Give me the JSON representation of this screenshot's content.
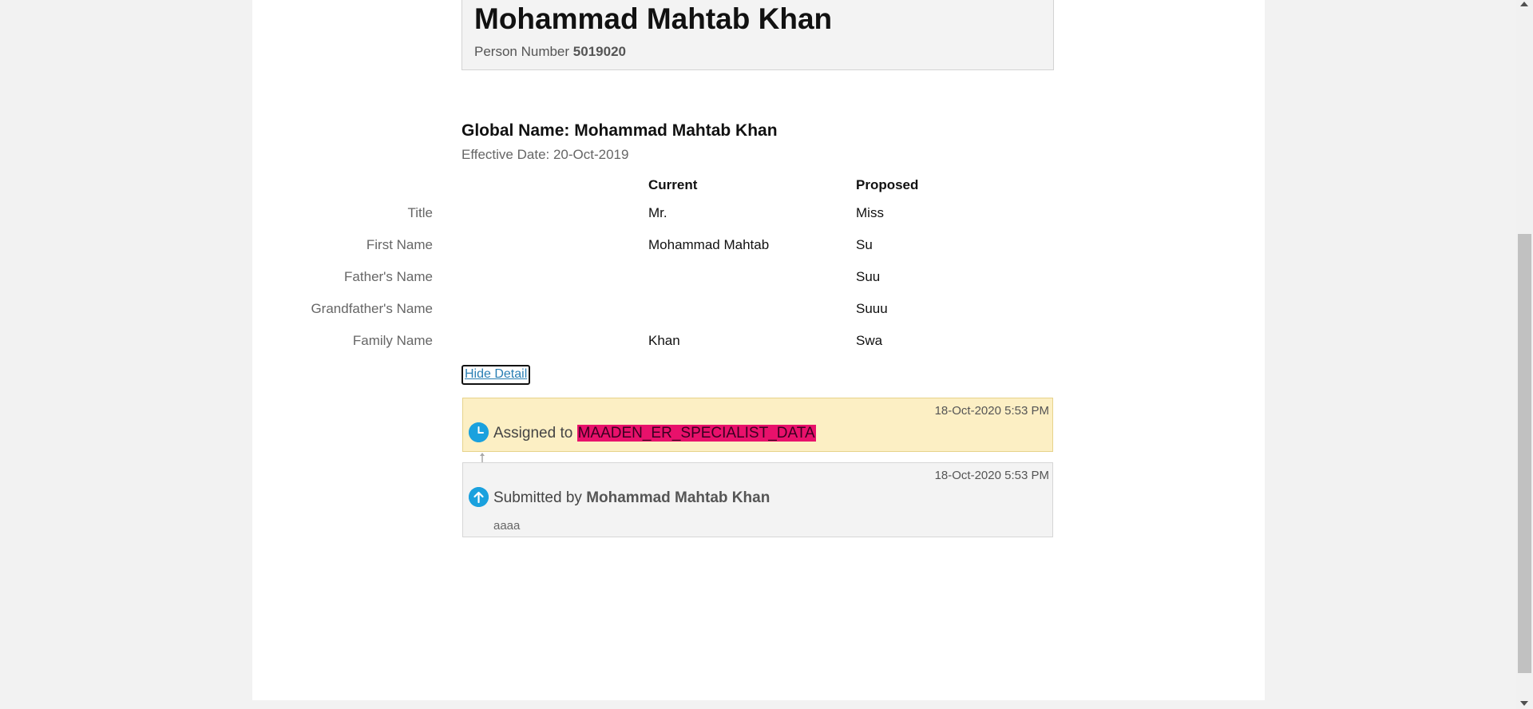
{
  "header": {
    "name": "Mohammad Mahtab Khan",
    "person_number_label": "Person Number",
    "person_number": "5019020"
  },
  "section": {
    "title": "Global Name: Mohammad Mahtab Khan",
    "effective_date": "Effective Date: 20-Oct-2019"
  },
  "compare": {
    "current_header": "Current",
    "proposed_header": "Proposed",
    "rows": [
      {
        "label": "Title",
        "current": "Mr.",
        "proposed": "Miss"
      },
      {
        "label": "First Name",
        "current": "Mohammad Mahtab",
        "proposed": "Su"
      },
      {
        "label": "Father's Name",
        "current": "",
        "proposed": "Suu"
      },
      {
        "label": "Grandfather's Name",
        "current": "",
        "proposed": "Suuu"
      },
      {
        "label": "Family Name",
        "current": "Khan",
        "proposed": "Swa"
      }
    ]
  },
  "hide_detail_label": "Hide Detail",
  "history": {
    "assigned": {
      "timestamp": "18-Oct-2020 5:53 PM",
      "prefix": "Assigned to",
      "assignee": "MAADEN_ER_SPECIALIST_DATA"
    },
    "submitted": {
      "timestamp": "18-Oct-2020 5:53 PM",
      "prefix": "Submitted by",
      "submitter": "Mohammad Mahtab Khan",
      "comment": "aaaa"
    }
  },
  "colors": {
    "accent": "#1aa1de",
    "assigned_bg": "#fcefc4",
    "highlight": "#e8116b",
    "link": "#2a7fb4"
  },
  "icons": {
    "assigned": "clock-icon",
    "submitted": "arrow-up-icon",
    "connector": "arrow-up-connector-icon"
  }
}
